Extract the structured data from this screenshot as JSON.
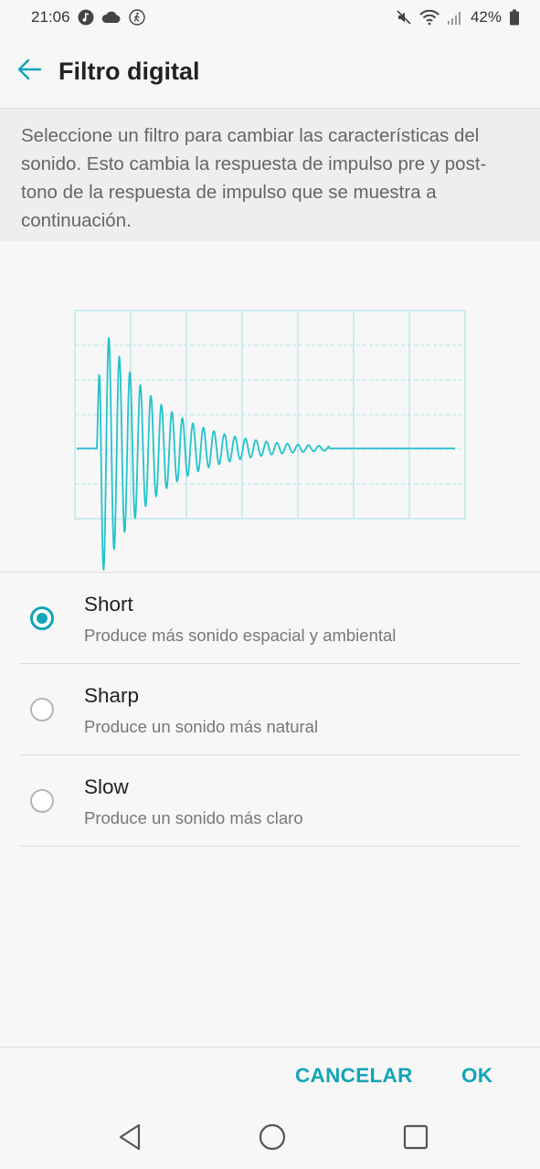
{
  "status_bar": {
    "time": "21:06",
    "battery": "42%",
    "left_icons": [
      "music-note-icon",
      "cloud-icon",
      "walking-icon"
    ],
    "right_icons": [
      "mute-icon",
      "wifi-icon",
      "signal-icon",
      "battery-icon"
    ]
  },
  "header": {
    "title": "Filtro digital"
  },
  "description": "Seleccione un filtro para cambiar las características del sonido. Esto cambia la respuesta de impulso pre y post-tono de la respuesta de impulso que se muestra a continuación.",
  "colors": {
    "accent": "#12a5b8",
    "waveform": "#26c2cc",
    "grid": "#bfe8ee"
  },
  "filter_options": [
    {
      "title": "Short",
      "subtitle": "Produce más sonido espacial y ambiental",
      "selected": true
    },
    {
      "title": "Sharp",
      "subtitle": "Produce un sonido más natural",
      "selected": false
    },
    {
      "title": "Slow",
      "subtitle": "Produce un sonido más claro",
      "selected": false
    }
  ],
  "actions": {
    "cancel_label": "CANCELAR",
    "ok_label": "OK"
  },
  "nav": {
    "icons": [
      "back-triangle-icon",
      "home-circle-icon",
      "recents-square-icon"
    ]
  }
}
